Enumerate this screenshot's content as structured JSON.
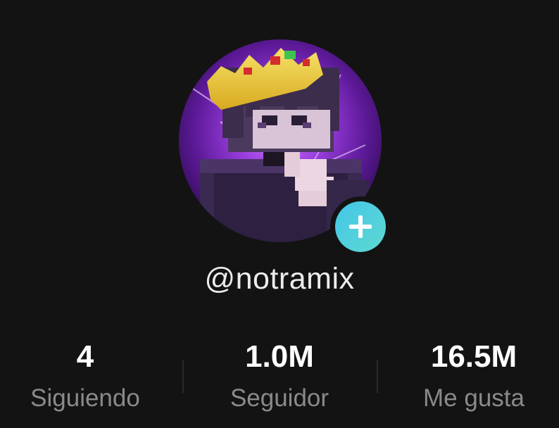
{
  "profile": {
    "username": "@notramix"
  },
  "stats": [
    {
      "value": "4",
      "label": "Siguiendo"
    },
    {
      "value": "1.0M",
      "label": "Seguidor"
    },
    {
      "value": "16.5M",
      "label": "Me gusta"
    }
  ],
  "icons": {
    "follow": "plus-icon"
  },
  "colors": {
    "background": "#131313",
    "username": "#ececec",
    "stat_value": "#ffffff",
    "stat_label": "#8a8a8a",
    "follow_button": "#4fcfe0",
    "avatar_glow": "#8a2fd0"
  }
}
